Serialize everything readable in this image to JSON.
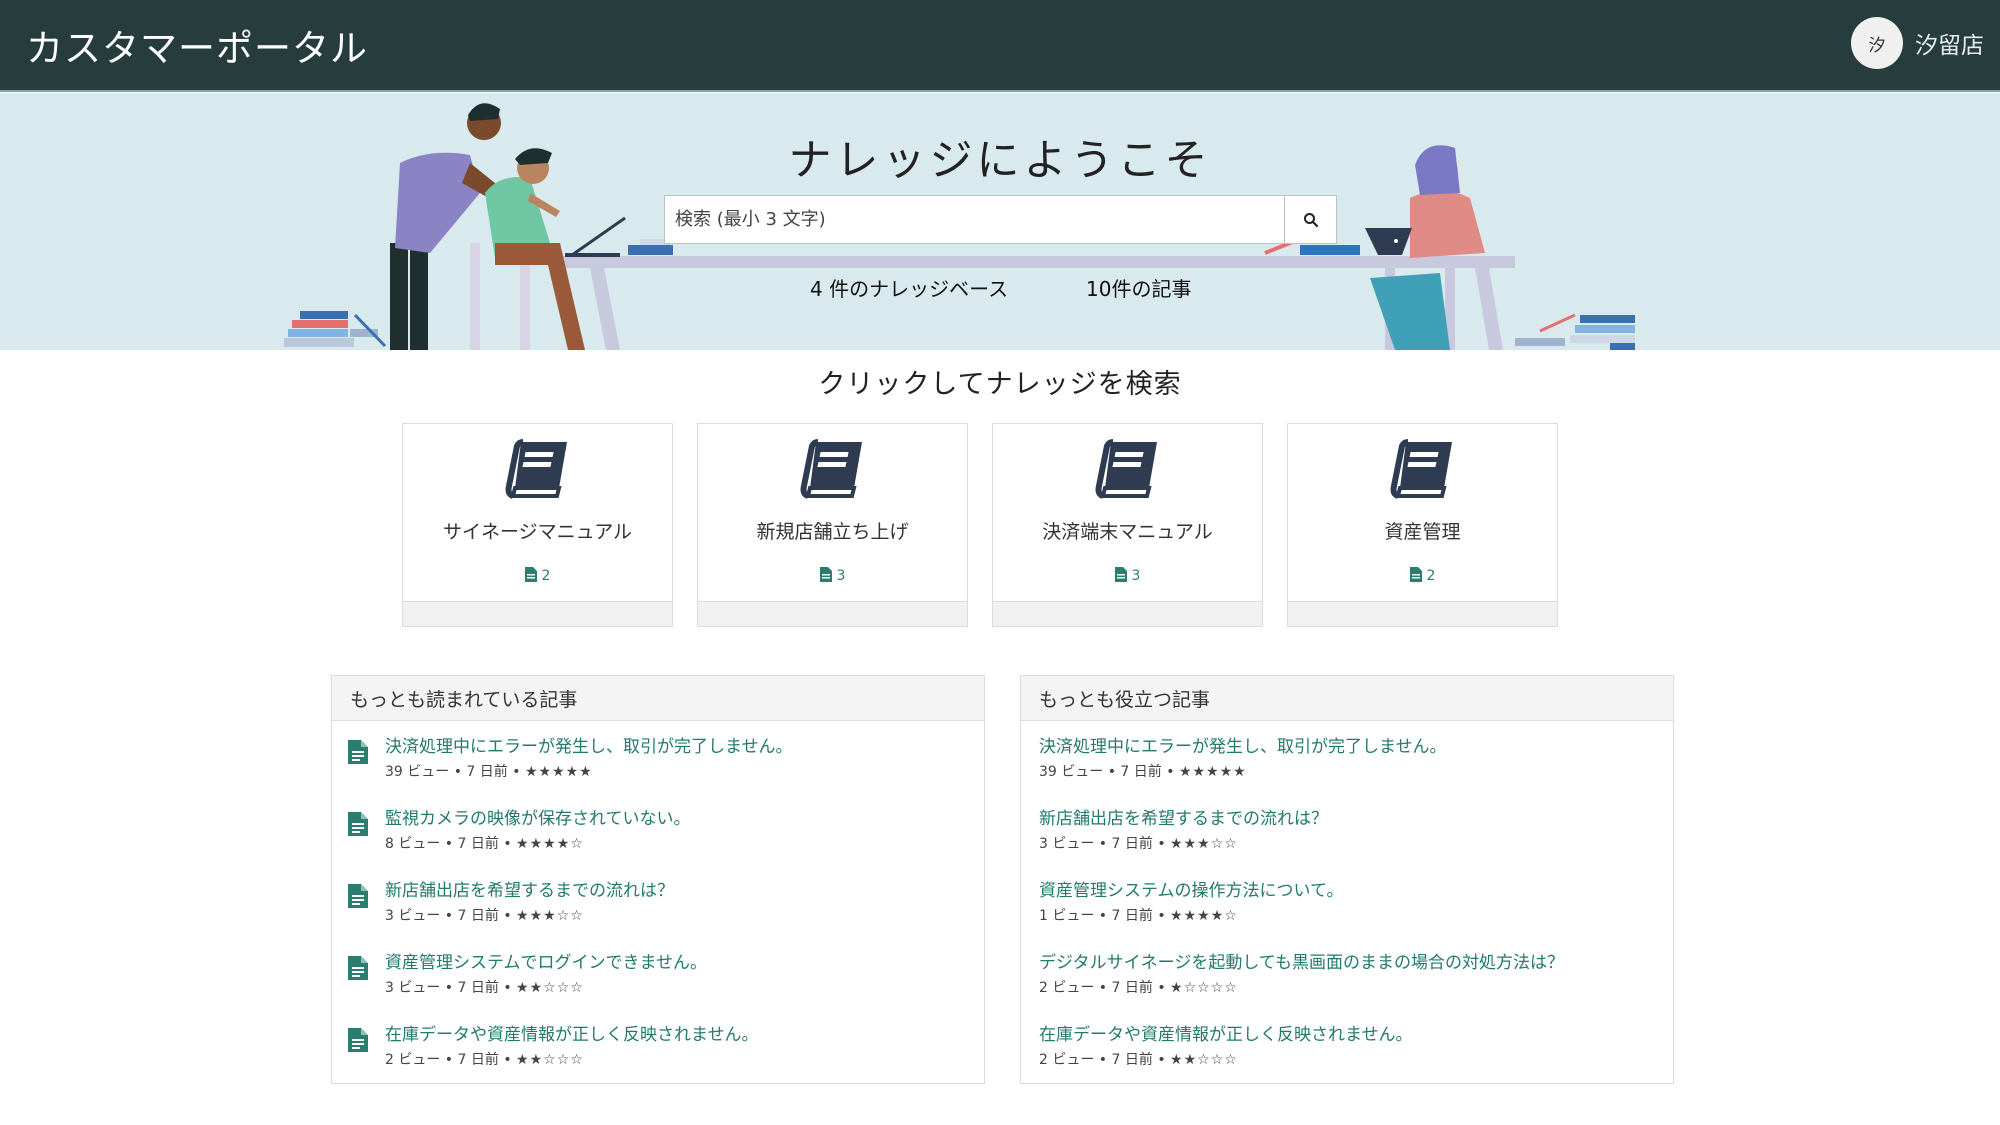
{
  "header": {
    "brand": "カスタマーポータル",
    "avatar_initial": "汐",
    "username": "汐留店"
  },
  "hero": {
    "title": "ナレッジにようこそ",
    "search_placeholder": "検索 (最小 3 文字)",
    "stat_kb": "4 件のナレッジベース",
    "stat_articles": "10件の記事"
  },
  "kb_section_title": "クリックしてナレッジを検索",
  "knowledge_bases": [
    {
      "title": "サイネージマニュアル",
      "count": "2"
    },
    {
      "title": "新規店舗立ち上げ",
      "count": "3"
    },
    {
      "title": "決済端末マニュアル",
      "count": "3"
    },
    {
      "title": "資産管理",
      "count": "2"
    }
  ],
  "most_read": {
    "title": "もっとも読まれている記事",
    "articles": [
      {
        "title": "決済処理中にエラーが発生し、取引が完了しません。",
        "meta": "39 ビュー  •  7 日前  •",
        "stars": "★★★★★"
      },
      {
        "title": "監視カメラの映像が保存されていない。",
        "meta": "8 ビュー  •  7 日前  •",
        "stars": "★★★★☆"
      },
      {
        "title": "新店舗出店を希望するまでの流れは？",
        "meta": "3 ビュー  •  7 日前  •",
        "stars": "★★★☆☆"
      },
      {
        "title": "資産管理システムでログインできません。",
        "meta": "3 ビュー  •  7 日前  •",
        "stars": "★★☆☆☆"
      },
      {
        "title": "在庫データや資産情報が正しく反映されません。",
        "meta": "2 ビュー  •  7 日前  •",
        "stars": "★★☆☆☆"
      }
    ]
  },
  "most_helpful": {
    "title": "もっとも役立つ記事",
    "articles": [
      {
        "title": "決済処理中にエラーが発生し、取引が完了しません。",
        "meta": "39 ビュー  •  7 日前  •",
        "stars": "★★★★★"
      },
      {
        "title": "新店舗出店を希望するまでの流れは？",
        "meta": "3 ビュー  •  7 日前  •",
        "stars": "★★★☆☆"
      },
      {
        "title": "資産管理システムの操作方法について。",
        "meta": "1 ビュー  •  7 日前  •",
        "stars": "★★★★☆"
      },
      {
        "title": "デジタルサイネージを起動しても黒画面のままの場合の対処方法は？",
        "meta": "2 ビュー  •  7 日前  •",
        "stars": "★☆☆☆☆"
      },
      {
        "title": "在庫データや資産情報が正しく反映されません。",
        "meta": "2 ビュー  •  7 日前  •",
        "stars": "★★☆☆☆"
      }
    ]
  },
  "colors": {
    "header_bg": "#263c3d",
    "hero_bg": "#d9eaef",
    "link": "#217a6c",
    "book": "#2f3b50"
  },
  "icons": {
    "search": "search-icon",
    "book": "book-icon",
    "document": "document-icon"
  }
}
